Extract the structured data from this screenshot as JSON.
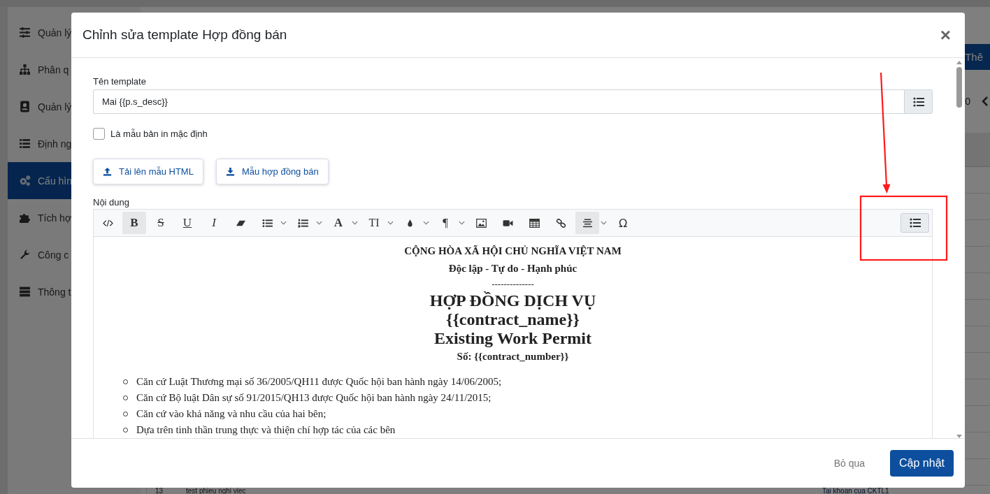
{
  "sidebar": {
    "items": [
      {
        "label": "Quản lý",
        "selected": false
      },
      {
        "label": "Phân q",
        "selected": false
      },
      {
        "label": "Quản lý",
        "selected": false
      },
      {
        "label": "Định ng",
        "selected": false
      },
      {
        "label": "Cấu hìn",
        "selected": true
      },
      {
        "label": "Tích hợ",
        "selected": false
      },
      {
        "label": "Công c",
        "selected": false
      },
      {
        "label": "Thông t",
        "selected": false
      }
    ]
  },
  "background": {
    "add_button": "Thê",
    "pager_text": "0",
    "last_row": {
      "number": "13",
      "name": "test phieu nghi viec",
      "owner": "Tai khoan cua CKTL1"
    }
  },
  "modal": {
    "title": "Chỉnh sửa template Hợp đồng bán",
    "close": "×",
    "name_field": {
      "label": "Tên template",
      "value": "Mai {{p.s_desc}}"
    },
    "default_checkbox": {
      "label": "Là mẫu bản in mặc định",
      "checked": false
    },
    "action_buttons": [
      "Tải lên mẫu HTML",
      "Mẫu hợp đồng bán"
    ],
    "content_label": "Nội dung",
    "toolbar": [
      {
        "kind": "code",
        "dropdown": false,
        "active": false
      },
      {
        "kind": "bold",
        "label": "B",
        "dropdown": false,
        "active": true
      },
      {
        "kind": "strike",
        "label": "S",
        "dropdown": false,
        "active": false
      },
      {
        "kind": "underline",
        "label": "U",
        "dropdown": false,
        "active": false
      },
      {
        "kind": "italic",
        "label": "I",
        "dropdown": false,
        "active": false
      },
      {
        "kind": "eraser",
        "dropdown": false,
        "active": false
      },
      {
        "kind": "bullets",
        "dropdown": true,
        "active": false
      },
      {
        "kind": "numbers",
        "dropdown": true,
        "active": false
      },
      {
        "kind": "font",
        "label": "A",
        "dropdown": true,
        "active": false
      },
      {
        "kind": "size",
        "label": "TI",
        "dropdown": true,
        "active": false
      },
      {
        "kind": "color",
        "dropdown": true,
        "active": false
      },
      {
        "kind": "paragraph",
        "label": "¶",
        "dropdown": true,
        "active": false
      },
      {
        "kind": "image",
        "dropdown": false,
        "active": false
      },
      {
        "kind": "video",
        "dropdown": false,
        "active": false
      },
      {
        "kind": "table",
        "dropdown": false,
        "active": false
      },
      {
        "kind": "link",
        "dropdown": false,
        "active": false
      },
      {
        "kind": "align",
        "dropdown": true,
        "active": true
      },
      {
        "kind": "symbol",
        "label": "Ω",
        "dropdown": false,
        "active": false
      }
    ],
    "document": {
      "header": [
        {
          "kind": "line",
          "text": "CỘNG HÒA XÃ HỘI CHỦ NGHĨA VIỆT NAM"
        },
        {
          "kind": "line",
          "text": "Độc lập - Tự do - Hạnh phúc"
        },
        {
          "kind": "rule",
          "text": "--------------"
        },
        {
          "kind": "title",
          "text": "HỢP ĐỒNG DỊCH VỤ"
        },
        {
          "kind": "title",
          "text": "{{contract_name}}"
        },
        {
          "kind": "title",
          "text": "Existing Work Permit"
        },
        {
          "kind": "line",
          "text": "Số: {{contract_number}}"
        }
      ],
      "bullets": [
        "Căn cứ Luật Thương mại số 36/2005/QH11 được Quốc hội ban hành ngày  14/06/2005;",
        "Căn cứ Bộ luật Dân sự số 91/2015/QH13 được Quốc hội ban hành ngày 24/11/2015;",
        "Căn cứ vào khả năng và nhu cầu của hai bên;",
        "Dựa trên tinh thần trung thực và thiện chí hợp tác của các bên"
      ]
    },
    "cancel": "Bỏ qua",
    "submit": "Cập nhật"
  }
}
